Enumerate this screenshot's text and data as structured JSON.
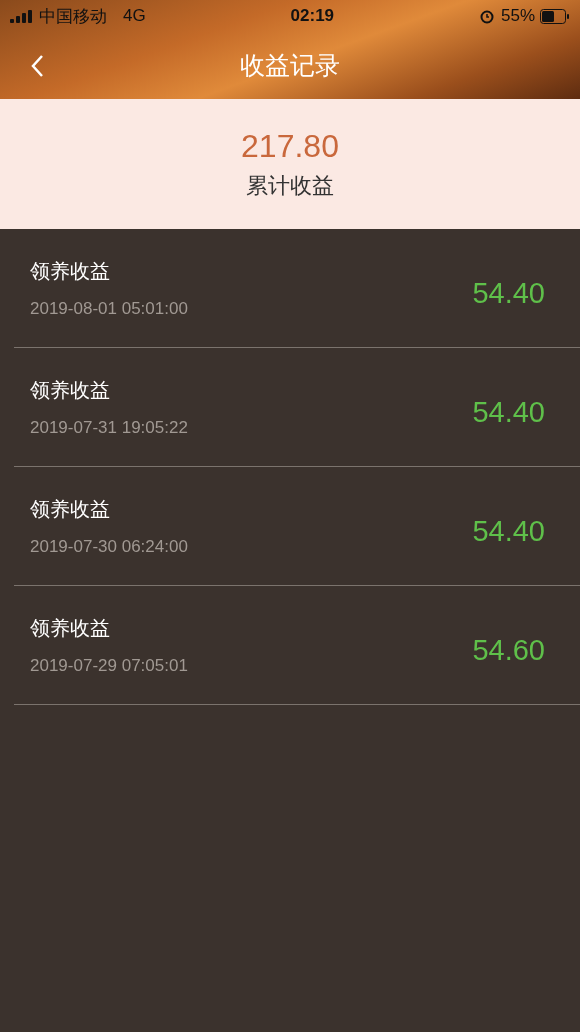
{
  "status_bar": {
    "carrier": "中国移动",
    "network": "4G",
    "time": "02:19",
    "battery": "55%"
  },
  "nav": {
    "title": "收益记录"
  },
  "summary": {
    "amount": "217.80",
    "label": "累计收益"
  },
  "records": [
    {
      "title": "领养收益",
      "time": "2019-08-01 05:01:00",
      "amount": "54.40"
    },
    {
      "title": "领养收益",
      "time": "2019-07-31 19:05:22",
      "amount": "54.40"
    },
    {
      "title": "领养收益",
      "time": "2019-07-30 06:24:00",
      "amount": "54.40"
    },
    {
      "title": "领养收益",
      "time": "2019-07-29 07:05:01",
      "amount": "54.60"
    }
  ]
}
